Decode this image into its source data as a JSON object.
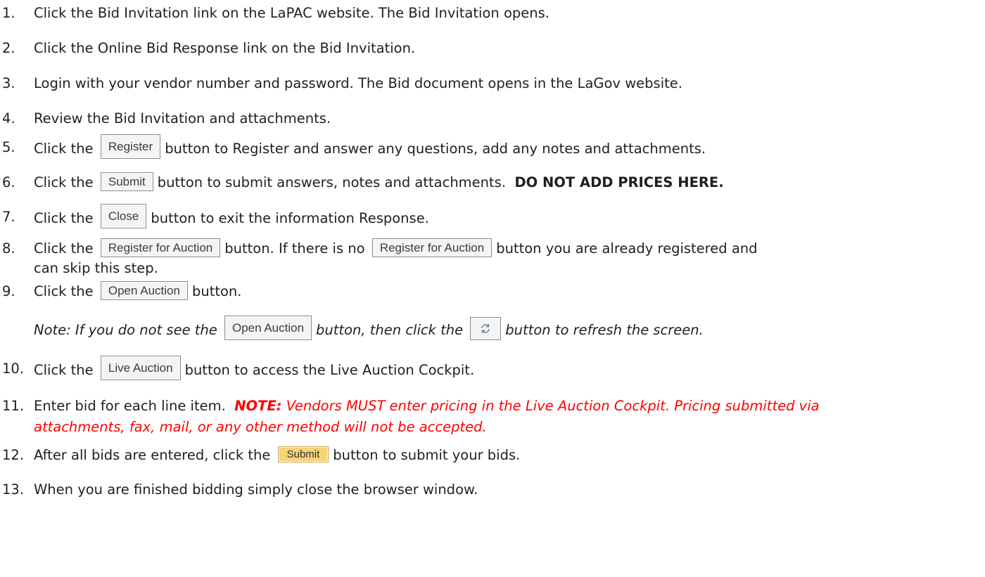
{
  "steps": [
    {
      "num": "1.",
      "text": "Click the Bid Invitation link on the LaPAC website.  The Bid Invitation opens."
    },
    {
      "num": "2.",
      "text": "Click the Online Bid Response link on the Bid Invitation."
    },
    {
      "num": "3.",
      "text": "Login with your vendor number and password.  The Bid document opens in the LaGov website."
    },
    {
      "num": "4.",
      "text": "Review the Bid Invitation and attachments."
    },
    {
      "num": "5.",
      "pre": "Click the",
      "button": "Register",
      "post": "button to Register and answer any questions, add any notes and attachments."
    },
    {
      "num": "6.",
      "pre": "Click the",
      "button": "Submit",
      "post": "button to submit answers, notes and attachments.",
      "bold": "DO NOT ADD PRICES HERE."
    },
    {
      "num": "7.",
      "pre": "Click the",
      "button": "Close",
      "post": "button to exit the information Response."
    },
    {
      "num": "8.",
      "pre": "Click the",
      "button": "Register for Auction",
      "mid": "button.  If there is no",
      "button2": "Register for Auction",
      "post": "button you are already registered and",
      "line2": "can skip this step."
    },
    {
      "num": "9.",
      "pre": "Click the",
      "button": "Open Auction",
      "post": "button."
    },
    {
      "note_pre": "Note: If you do not see the",
      "button": "Open Auction",
      "note_mid": "button, then click the",
      "note_post": "button to refresh the screen."
    },
    {
      "num": "10.",
      "pre": "Click the",
      "button": "Live Auction",
      "post": "button to access the Live Auction Cockpit."
    },
    {
      "num": "11.",
      "pre": "Enter bid for each line item.",
      "red_bold": "NOTE:",
      "red_text": "Vendors MUST enter pricing in the Live Auction Cockpit.  Pricing submitted via",
      "line2": "attachments, fax, mail, or any other method will not be accepted."
    },
    {
      "num": "12.",
      "pre": "After all bids are entered, click the",
      "button": "Submit",
      "post": "button to submit your bids."
    },
    {
      "num": "13.",
      "text": "When you are finished bidding simply close the browser window."
    }
  ],
  "icons": {
    "refresh": "refresh-icon"
  },
  "colors": {
    "note_red": "#ff0000",
    "submit_orange": "#f6d27a"
  }
}
